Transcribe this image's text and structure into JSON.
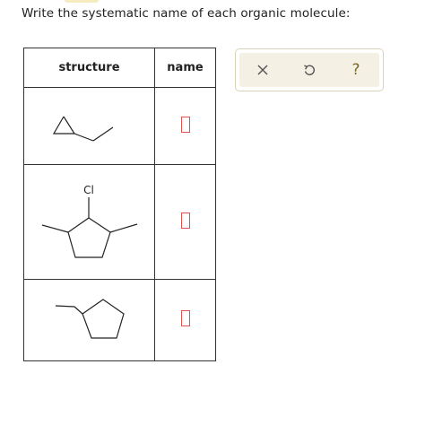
{
  "prompt": "Write the systematic name of each organic molecule:",
  "table": {
    "headers": {
      "structure": "structure",
      "name": "name"
    },
    "rows": [
      {
        "structure": "ethylcyclopropane skeletal structure",
        "name_value": ""
      },
      {
        "structure": "chloro-dimethylcyclopentane skeletal structure",
        "atom_label": "Cl",
        "name_value": ""
      },
      {
        "structure": "ethylcyclopentane skeletal structure",
        "name_value": ""
      }
    ]
  },
  "toolbar": {
    "clear_icon": "close-icon",
    "undo_icon": "undo-icon",
    "help_label": "?",
    "accent_color": "#7a6a2a"
  },
  "colors": {
    "field_border": "#d9534f",
    "toolbar_bg": "#f4f1e4"
  }
}
